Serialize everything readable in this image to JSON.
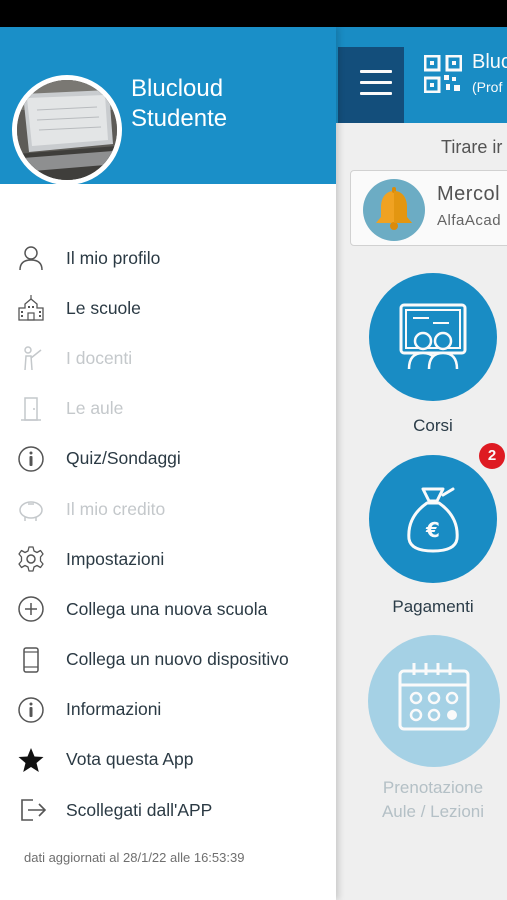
{
  "main": {
    "brand_title": "Bluc",
    "brand_subtitle": "(Prof",
    "pull_hint": "Tirare ir",
    "notice": {
      "day": "Mercol",
      "school": "AlfaAcad"
    },
    "tiles": [
      {
        "label": "Corsi",
        "icon": "teachers-board-icon",
        "color": "#1a8fc8",
        "enabled": true
      },
      {
        "label": "Pagamenti",
        "icon": "money-bag-euro-icon",
        "color": "#1a8fc8",
        "enabled": true,
        "badge": "2"
      },
      {
        "label_line1": "Prenotazione",
        "label_line2": "Aule / Lezioni",
        "icon": "calendar-icon",
        "color": "#a9d6ea",
        "enabled": false
      }
    ]
  },
  "drawer": {
    "user_line1": "Blucloud",
    "user_line2": "Studente",
    "menu": [
      {
        "label": "Il mio profilo",
        "icon": "user-icon",
        "enabled": true
      },
      {
        "label": "Le scuole",
        "icon": "school-building-icon",
        "enabled": true
      },
      {
        "label": "I docenti",
        "icon": "teacher-pointer-icon",
        "enabled": false
      },
      {
        "label": "Le aule",
        "icon": "door-icon",
        "enabled": false
      },
      {
        "label": "Quiz/Sondaggi",
        "icon": "info-circle-icon",
        "enabled": true
      },
      {
        "label": "Il mio credito",
        "icon": "piggy-bank-icon",
        "enabled": false
      },
      {
        "label": "Impostazioni",
        "icon": "gear-icon",
        "enabled": true
      },
      {
        "label": "Collega una nuova scuola",
        "icon": "plus-circle-icon",
        "enabled": true
      },
      {
        "label": "Collega un nuovo dispositivo",
        "icon": "phone-icon",
        "enabled": true
      },
      {
        "label": "Informazioni",
        "icon": "info-circle-icon",
        "enabled": true
      },
      {
        "label": "Vota questa App",
        "icon": "star-icon",
        "enabled": true
      },
      {
        "label": "Scollegati dall'APP",
        "icon": "logout-icon",
        "enabled": true
      }
    ],
    "updated_text": "dati aggiornati al 28/1/22 alle 16:53:39"
  },
  "colors": {
    "brand_blue": "#1a8fc8",
    "dark_blue": "#14507e",
    "disabled_text": "#c4c8cb",
    "badge_red": "#e31b23"
  }
}
